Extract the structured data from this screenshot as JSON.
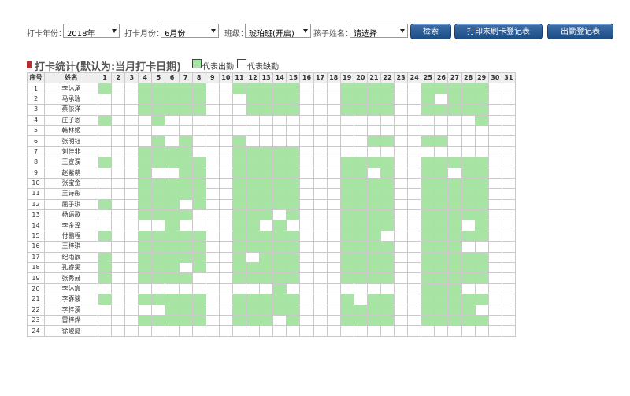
{
  "filters": {
    "year_label": "打卡年份：",
    "year_value": "2018年",
    "month_label": "打卡月份：",
    "month_value": "6月份",
    "class_label": "班级：",
    "class_value": "琥珀班(开启)",
    "child_label": "孩子姓名：",
    "child_value": "请选择"
  },
  "buttons": {
    "search": "检索",
    "print_missing": "打印未刷卡登记表",
    "attendance_register": "出勤登记表"
  },
  "section": {
    "title": "打卡统计(默认为:当月打卡日期)",
    "legend_present": "代表出勤",
    "legend_absent": "代表缺勤"
  },
  "colors": {
    "present": "#a8e4a4",
    "absent": "#ffffff",
    "button": "#2a5a94",
    "title_mark": "#b3322f"
  },
  "table": {
    "col_index": "序号",
    "col_name": "姓名",
    "days": [
      "1",
      "2",
      "3",
      "4",
      "5",
      "6",
      "7",
      "8",
      "9",
      "10",
      "11",
      "12",
      "13",
      "14",
      "15",
      "16",
      "17",
      "18",
      "19",
      "20",
      "21",
      "22",
      "23",
      "24",
      "25",
      "26",
      "27",
      "28",
      "29",
      "30",
      "31"
    ],
    "rows": [
      {
        "no": "1",
        "name": "李沐承",
        "present": [
          1,
          4,
          5,
          6,
          7,
          8,
          11,
          12,
          13,
          14,
          15,
          19,
          20,
          21,
          22,
          25,
          26,
          27,
          28,
          29
        ]
      },
      {
        "no": "2",
        "name": "马承瑞",
        "present": [
          4,
          5,
          6,
          7,
          8,
          12,
          13,
          14,
          15,
          19,
          20,
          21,
          22,
          25,
          27,
          28,
          29
        ]
      },
      {
        "no": "3",
        "name": "蔡依洋",
        "present": [
          4,
          5,
          6,
          7,
          8,
          12,
          13,
          14,
          15,
          19,
          20,
          21,
          22,
          25,
          26,
          27,
          28,
          29
        ]
      },
      {
        "no": "4",
        "name": "庄子恩",
        "present": [
          1,
          5,
          29
        ]
      },
      {
        "no": "5",
        "name": "韩林姬",
        "present": []
      },
      {
        "no": "6",
        "name": "张明钰",
        "present": [
          5,
          7,
          11,
          21,
          22,
          25,
          26
        ]
      },
      {
        "no": "7",
        "name": "刘佳非",
        "present": [
          4,
          5,
          6,
          7,
          11,
          12,
          13,
          14,
          15
        ]
      },
      {
        "no": "8",
        "name": "王宣淏",
        "present": [
          1,
          4,
          5,
          6,
          7,
          8,
          11,
          12,
          13,
          14,
          15,
          19,
          20,
          21,
          22,
          25,
          26,
          27,
          28,
          29
        ]
      },
      {
        "no": "9",
        "name": "赵紫萌",
        "present": [
          4,
          7,
          8,
          11,
          12,
          13,
          14,
          15,
          19,
          20,
          22,
          25,
          26,
          28,
          29
        ]
      },
      {
        "no": "10",
        "name": "张宝金",
        "present": [
          4,
          5,
          6,
          7,
          8,
          11,
          12,
          13,
          14,
          15,
          19,
          20,
          21,
          22,
          25,
          26,
          27,
          28,
          29
        ]
      },
      {
        "no": "11",
        "name": "王诗彤",
        "present": [
          4,
          5,
          6,
          7,
          8,
          11,
          12,
          13,
          14,
          15,
          19,
          20,
          21,
          22,
          25,
          26,
          27,
          28,
          29
        ]
      },
      {
        "no": "12",
        "name": "屈子琪",
        "present": [
          1,
          4,
          5,
          6,
          8,
          11,
          12,
          13,
          14,
          15,
          19,
          20,
          21,
          22,
          25,
          26,
          27,
          28,
          29
        ]
      },
      {
        "no": "13",
        "name": "杨语歌",
        "present": [
          4,
          5,
          6,
          7,
          11,
          12,
          13,
          15,
          19,
          20,
          21,
          22,
          25,
          26,
          27,
          28,
          29
        ]
      },
      {
        "no": "14",
        "name": "李金泽",
        "present": [
          6,
          11,
          12,
          14,
          19,
          20,
          21,
          22,
          25,
          26,
          27,
          29
        ]
      },
      {
        "no": "15",
        "name": "付鹏程",
        "present": [
          1,
          4,
          5,
          6,
          7,
          8,
          11,
          12,
          13,
          14,
          15,
          19,
          20,
          21,
          25,
          26,
          27,
          28,
          29
        ]
      },
      {
        "no": "16",
        "name": "王梓琪",
        "present": [
          4,
          5,
          6,
          7,
          8,
          11,
          12,
          13,
          14,
          15,
          19,
          20,
          21,
          22,
          25,
          26,
          27
        ]
      },
      {
        "no": "17",
        "name": "纪雨辰",
        "present": [
          1,
          4,
          5,
          6,
          7,
          8,
          11,
          13,
          14,
          15,
          19,
          20,
          21,
          22,
          25,
          26,
          27,
          28,
          29
        ]
      },
      {
        "no": "18",
        "name": "孔睿雯",
        "present": [
          1,
          4,
          5,
          6,
          8,
          11,
          12,
          13,
          14,
          15,
          19,
          20,
          21,
          22,
          25,
          26,
          27,
          28,
          29
        ]
      },
      {
        "no": "19",
        "name": "张秀赫",
        "present": [
          1,
          4,
          5,
          6,
          7,
          11,
          12,
          13,
          14,
          15,
          19,
          20,
          21,
          22,
          25,
          26,
          27,
          28,
          29
        ]
      },
      {
        "no": "20",
        "name": "李沐宸",
        "present": [
          14,
          25,
          26,
          27
        ]
      },
      {
        "no": "21",
        "name": "李孬骏",
        "present": [
          1,
          4,
          5,
          6,
          7,
          8,
          11,
          12,
          13,
          14,
          15,
          19,
          21,
          22,
          25,
          26,
          27,
          28,
          29
        ]
      },
      {
        "no": "22",
        "name": "李梓溪",
        "present": [
          6,
          7,
          8,
          11,
          12,
          13,
          14,
          15,
          19,
          20,
          21,
          22,
          25,
          26,
          27,
          28
        ]
      },
      {
        "no": "23",
        "name": "雷梓烨",
        "present": [
          4,
          5,
          6,
          7,
          8,
          11,
          12,
          13,
          15,
          19,
          20,
          21,
          22,
          25,
          26,
          27,
          28,
          29
        ]
      },
      {
        "no": "24",
        "name": "徐峻懿",
        "present": []
      }
    ]
  }
}
